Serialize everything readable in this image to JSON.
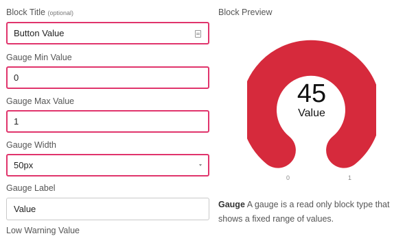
{
  "form": {
    "block_title_label": "Block Title",
    "block_title_hint": "(optional)",
    "block_title_value": "Button Value",
    "min_label": "Gauge Min Value",
    "min_value": "0",
    "max_label": "Gauge Max Value",
    "max_value": "1",
    "width_label": "Gauge Width",
    "width_value": "50px",
    "gauge_label_label": "Gauge Label",
    "gauge_label_value": "Value",
    "low_warning_label": "Low Warning Value"
  },
  "preview": {
    "title": "Block Preview",
    "gauge_value": "45",
    "gauge_label": "Value",
    "min_tick": "0",
    "max_tick": "1",
    "gauge_color": "#d62a3c",
    "description_name": "Gauge",
    "description_text": "A gauge is a read only block type that shows a fixed range of values."
  },
  "colors": {
    "invalid_border": "#e0336b",
    "gauge_fill": "#d62a3c"
  }
}
